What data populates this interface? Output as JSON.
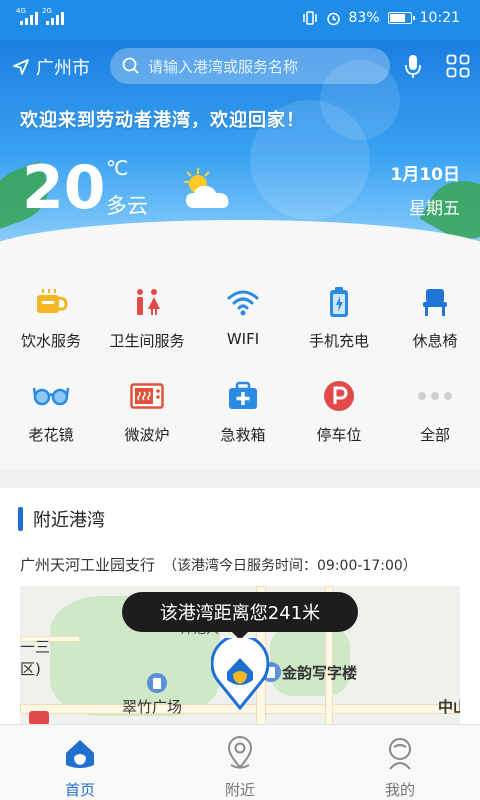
{
  "status_bar": {
    "signal1_tag": "4G",
    "signal2_tag": "2G",
    "battery_percent": "83%",
    "battery_level": 0.83,
    "time": "10:21"
  },
  "header": {
    "location": "广州市",
    "search_placeholder": "请输入港湾或服务名称",
    "welcome": "欢迎来到劳动者港湾，欢迎回家！",
    "weather": {
      "temperature": "20",
      "unit": "℃",
      "description": "多云",
      "icon": "partly-cloudy-icon",
      "date": "1月10日",
      "weekday": "星期五"
    }
  },
  "services": [
    {
      "label": "饮水服务",
      "icon": "cup-icon"
    },
    {
      "label": "卫生间服务",
      "icon": "restroom-icon"
    },
    {
      "label": "WIFI",
      "icon": "wifi-icon"
    },
    {
      "label": "手机充电",
      "icon": "battery-charge-icon"
    },
    {
      "label": "休息椅",
      "icon": "chair-icon"
    },
    {
      "label": "老花镜",
      "icon": "glasses-icon"
    },
    {
      "label": "微波炉",
      "icon": "microwave-icon"
    },
    {
      "label": "急救箱",
      "icon": "first-aid-icon"
    },
    {
      "label": "停车位",
      "icon": "parking-icon"
    },
    {
      "label": "全部",
      "icon": "more-dots-icon"
    }
  ],
  "nearby": {
    "title": "附近港湾",
    "station_name": "广州天河工业园支行",
    "station_hours": "（该港湾今日服务时间：09:00-17:00）",
    "distance_tip": "该港湾距离您241米",
    "map_labels": {
      "road_top": "帅范大",
      "building": "金韵写字楼",
      "plaza": "翠竹广场",
      "left_top": "一三",
      "left_mid": "区)",
      "right": "中山"
    }
  },
  "bottom_nav": [
    {
      "label": "首页",
      "icon": "home-icon",
      "active": true
    },
    {
      "label": "附近",
      "icon": "location-pin-icon",
      "active": false
    },
    {
      "label": "我的",
      "icon": "profile-icon",
      "active": false
    }
  ],
  "colors": {
    "primary": "#1f6fd0",
    "hero_top": "#1a7fe0",
    "tip_bg": "#1d1d1d"
  }
}
